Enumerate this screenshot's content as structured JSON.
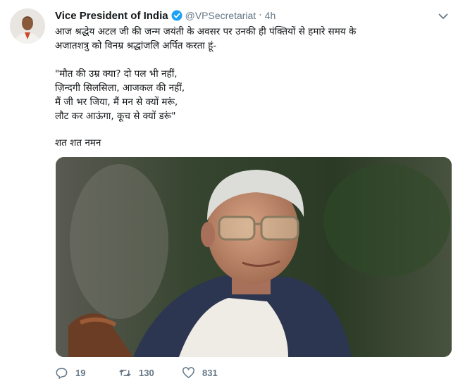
{
  "tweet": {
    "display_name": "Vice President of India",
    "handle": "@VPSecretariat",
    "separator": "·",
    "time": "4h",
    "body": {
      "intro_line1": "आज श्रद्धेय अटल जी की जन्म जयंती के अवसर पर उनकी ही पंक्तियों से हमारे समय के",
      "intro_line2": "अजातशत्रु को विनम्र श्रद्धांजलि अर्पित करता हूं-",
      "poem_line1": "\"मौत की उम्र क्या? दो पल भी नहीं,",
      "poem_line2": "ज़िन्दगी सिलसिला, आजकल की नहीं,",
      "poem_line3": "मैं जी भर जिया, मैं मन से क्यों मरूं,",
      "poem_line4": "लौट कर आऊंगा, कूच से क्यों डरूं\"",
      "closing": "शत शत नमन"
    },
    "stats": {
      "replies": "19",
      "retweets": "130",
      "likes": "831"
    },
    "icons": {
      "verified": "verified-badge-icon",
      "caret": "chevron-down-icon",
      "reply": "reply-icon",
      "retweet": "retweet-icon",
      "like": "heart-icon"
    },
    "colors": {
      "text": "#14171a",
      "secondary": "#657786",
      "verified": "#1da1f2"
    }
  }
}
